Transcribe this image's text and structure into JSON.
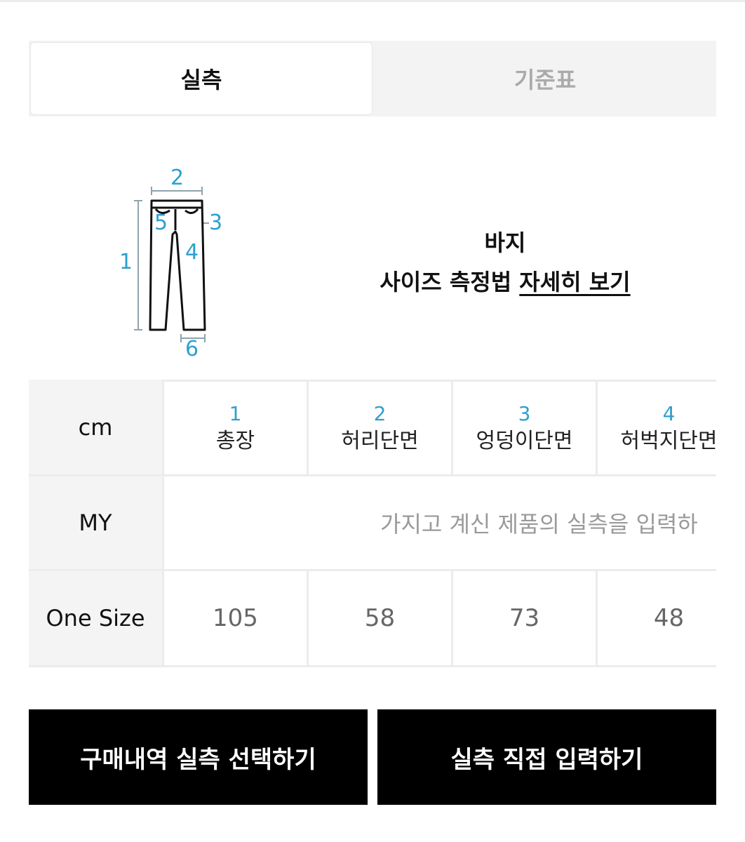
{
  "tabs": [
    {
      "label": "실측",
      "active": true
    },
    {
      "label": "기준표",
      "active": false
    }
  ],
  "diagram": {
    "labels": [
      "1",
      "2",
      "3",
      "4",
      "5",
      "6"
    ],
    "guide_color": "#2ea0cf"
  },
  "product": {
    "name": "바지",
    "howto_prefix": "사이즈 측정법",
    "howto_link": "자세히 보기"
  },
  "table": {
    "unit_label": "cm",
    "columns": [
      {
        "num": "1",
        "label": "총장"
      },
      {
        "num": "2",
        "label": "허리단면"
      },
      {
        "num": "3",
        "label": "엉덩이단면"
      },
      {
        "num": "4",
        "label": "허벅지단면"
      }
    ],
    "my_row": {
      "label": "MY",
      "placeholder": "가지고 계신 제품의 실측을 입력하"
    },
    "size_row": {
      "label": "One Size",
      "values": [
        "105",
        "58",
        "73",
        "48"
      ]
    }
  },
  "buttons": {
    "purchase_select": "구매내역 실측 선택하기",
    "direct_input": "실측 직접 입력하기"
  }
}
